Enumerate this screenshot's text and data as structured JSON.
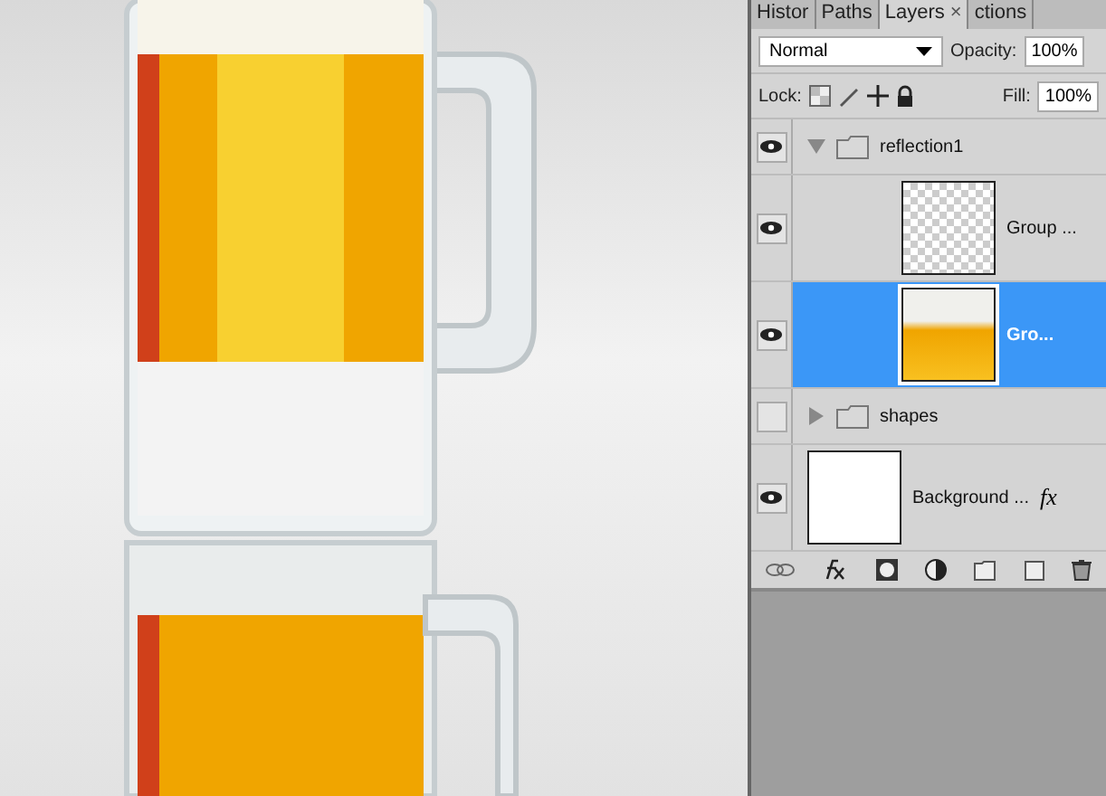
{
  "tabs": [
    {
      "label": "Histor",
      "selected": false
    },
    {
      "label": "Paths",
      "selected": false
    },
    {
      "label": "Layers",
      "selected": true,
      "close": "×"
    },
    {
      "label": "ctions",
      "selected": false
    }
  ],
  "blend_mode": "Normal",
  "opacity_label": "Opacity:",
  "opacity": "100%",
  "lock_label": "Lock:",
  "fill_label": "Fill:",
  "fill": "100%",
  "layers": [
    {
      "kind": "group",
      "name": "reflection1",
      "visible": true,
      "expanded": true,
      "selected": false,
      "children": [
        {
          "kind": "layer",
          "name": "Group ...",
          "visible": true,
          "selected": false
        },
        {
          "kind": "layer",
          "name": "Gro...",
          "visible": true,
          "selected": true
        }
      ]
    },
    {
      "kind": "group",
      "name": "shapes",
      "visible": false,
      "expanded": false,
      "selected": false
    },
    {
      "kind": "layer",
      "name": "Background ...",
      "visible": true,
      "selected": false,
      "effects": "fx"
    }
  ]
}
